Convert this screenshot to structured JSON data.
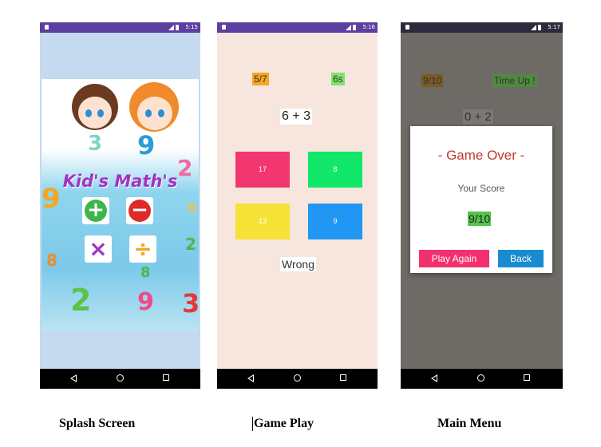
{
  "phones": {
    "status_time_1": "5:15",
    "status_time_2": "5:16",
    "status_time_3": "5:17"
  },
  "splash": {
    "title": "Kid's Math's",
    "ops": [
      "+",
      "−",
      "×",
      "÷"
    ]
  },
  "game": {
    "progress": "5/7",
    "timer": "6s",
    "question": "6 + 3",
    "answers": [
      "17",
      "8",
      "13",
      "9"
    ],
    "answer_colors": [
      "#f2366f",
      "#11e769",
      "#f6e136",
      "#2196f3"
    ],
    "feedback": "Wrong"
  },
  "menu": {
    "progress": "9/10",
    "status": "Time Up !",
    "question": "0 + 2",
    "dialog_title": "- Game Over -",
    "dialog_subtitle": "Your Score",
    "score": "9/10",
    "play_again": "Play Again",
    "back": "Back"
  },
  "captions": {
    "splash": "Splash Screen",
    "game": "Game Play",
    "menu": "Main Menu"
  }
}
